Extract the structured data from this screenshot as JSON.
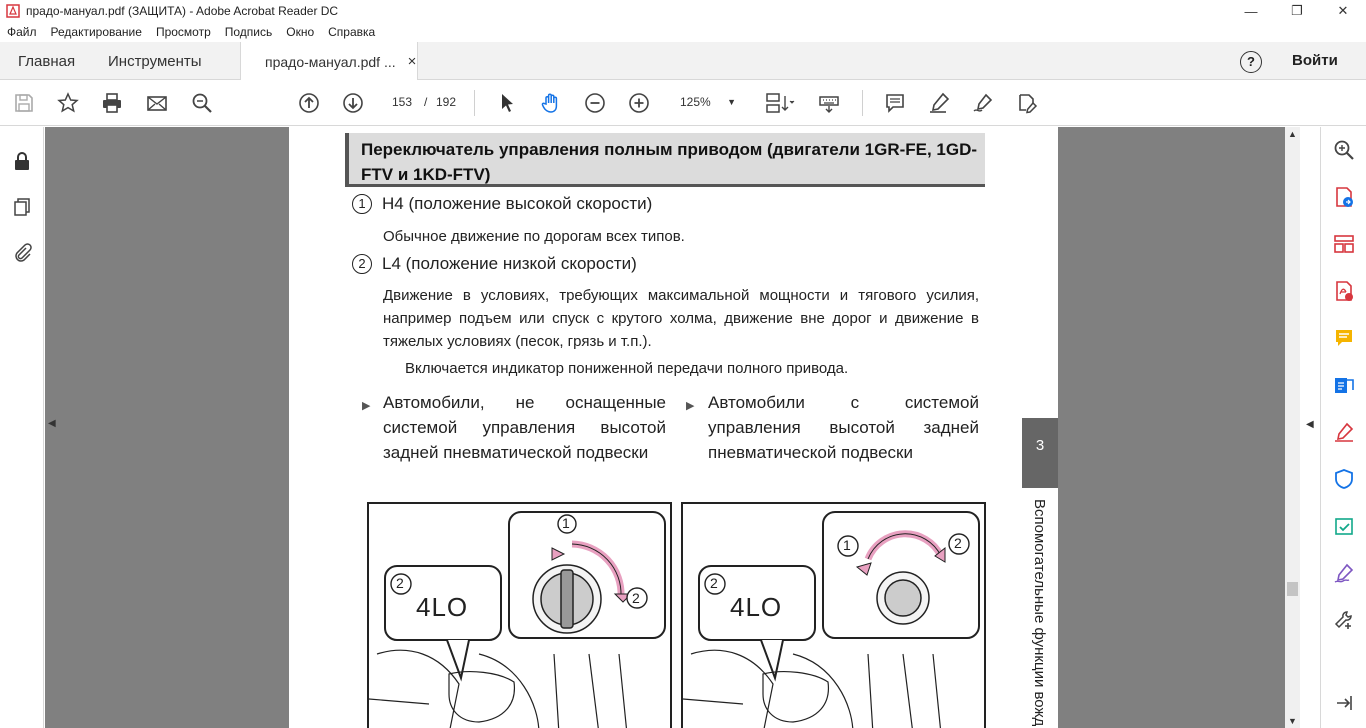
{
  "window": {
    "title": "прадо-мануал.pdf (ЗАЩИТА) - Adobe Acrobat Reader DC",
    "minimize": "—",
    "maximize": "❐",
    "close": "✕"
  },
  "menu": [
    "Файл",
    "Редактирование",
    "Просмотр",
    "Подпись",
    "Окно",
    "Справка"
  ],
  "tabs": {
    "home": "Главная",
    "tools": "Инструменты",
    "document": "прадо-мануал.pdf ...",
    "close": "×"
  },
  "account": {
    "help": "?",
    "signin": "Войти"
  },
  "toolbar": {
    "page_current": "153",
    "page_sep": "/",
    "page_total": "192",
    "zoom": "125%"
  },
  "page": {
    "heading": "Переключатель управления полным приводом (двигатели 1GR-FE, 1GD-FTV и 1KD-FTV)",
    "item1_num": "1",
    "item1_title": "H4 (положение высокой скорости)",
    "item1_text": "Обычное движение по дорогам всех типов.",
    "item2_num": "2",
    "item2_title": "L4 (положение низкой скорости)",
    "item2_text": "Движение в условиях, требующих максимальной мощности и тягового усилия, например подъем или спуск с крутого холма, движение вне дорог и движение в тяжелых условиях (песок, грязь и т.п.).",
    "item2_note": "Включается индикатор пониженной передачи полного привода.",
    "variant_left": "Автомобили, не оснащенные системой управления высотой задней пневматической подвески",
    "variant_right": "Автомобили с системой управления высотой задней пневматической подвески",
    "chapter": "3",
    "section": "Вспомогательные функции вожд",
    "fig_left": {
      "callout2": "2",
      "display": "4LO",
      "callout1": "1",
      "callout2b": "2"
    },
    "fig_right": {
      "callout2": "2",
      "display": "4LO",
      "callout1": "1",
      "callout2b": "2"
    }
  },
  "colors": {
    "viewport_bg": "#808080",
    "heading_bg": "#dcdcdc",
    "arrow_pink": "#e8a0c0",
    "acrobat_red": "#d7373f"
  }
}
